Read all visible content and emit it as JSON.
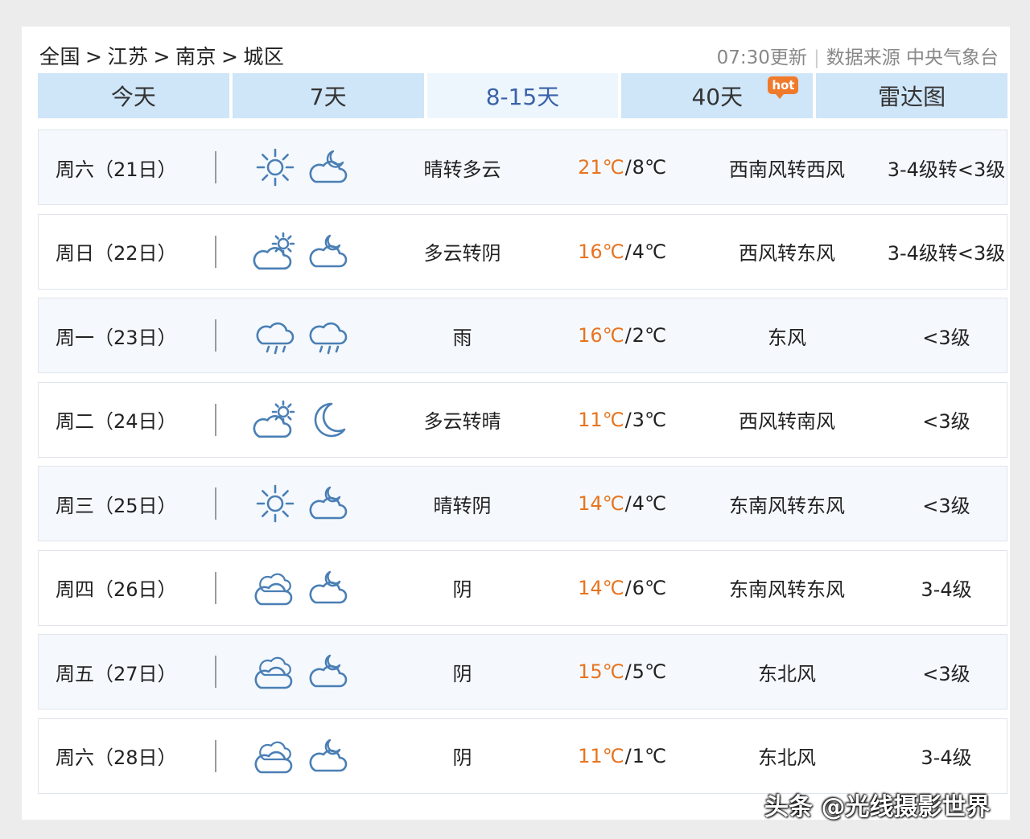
{
  "breadcrumb": {
    "items": [
      "全国",
      "江苏",
      "南京",
      "城区"
    ],
    "separator": ">"
  },
  "update": {
    "time": "07:30更新",
    "source": "数据来源 中央气象台"
  },
  "tabs": [
    {
      "label": "今天"
    },
    {
      "label": "7天"
    },
    {
      "label": "8-15天",
      "active": true
    },
    {
      "label": "40天",
      "badge": "hot"
    },
    {
      "label": "雷达图"
    }
  ],
  "colors": {
    "high_temp": "#e8741f",
    "tab_bg": "#cfe5f8",
    "active_tab_text": "#3a62a8",
    "icon_stroke": "#4a7fb5"
  },
  "forecast": [
    {
      "date": "周六（21日）",
      "day_icon": "sunny-icon",
      "night_icon": "cloudy-night-icon",
      "desc": "晴转多云",
      "high": "21℃",
      "low": "8℃",
      "wind": "西南风转西风",
      "level": "3-4级转<3级"
    },
    {
      "date": "周日（22日）",
      "day_icon": "partly-cloudy-day-icon",
      "night_icon": "partly-cloudy-night-icon",
      "desc": "多云转阴",
      "high": "16℃",
      "low": "4℃",
      "wind": "西风转东风",
      "level": "3-4级转<3级"
    },
    {
      "date": "周一（23日）",
      "day_icon": "rain-icon",
      "night_icon": "rain-icon",
      "desc": "雨",
      "high": "16℃",
      "low": "2℃",
      "wind": "东风",
      "level": "<3级"
    },
    {
      "date": "周二（24日）",
      "day_icon": "partly-cloudy-day-icon",
      "night_icon": "moon-icon",
      "desc": "多云转晴",
      "high": "11℃",
      "low": "3℃",
      "wind": "西风转南风",
      "level": "<3级"
    },
    {
      "date": "周三（25日）",
      "day_icon": "sunny-icon",
      "night_icon": "partly-cloudy-night-icon",
      "desc": "晴转阴",
      "high": "14℃",
      "low": "4℃",
      "wind": "东南风转东风",
      "level": "<3级"
    },
    {
      "date": "周四（26日）",
      "day_icon": "overcast-icon",
      "night_icon": "partly-cloudy-night-icon",
      "desc": "阴",
      "high": "14℃",
      "low": "6℃",
      "wind": "东南风转东风",
      "level": "3-4级"
    },
    {
      "date": "周五（27日）",
      "day_icon": "overcast-icon",
      "night_icon": "partly-cloudy-night-icon",
      "desc": "阴",
      "high": "15℃",
      "low": "5℃",
      "wind": "东北风",
      "level": "<3级"
    },
    {
      "date": "周六（28日）",
      "day_icon": "overcast-icon",
      "night_icon": "partly-cloudy-night-icon",
      "desc": "阴",
      "high": "11℃",
      "low": "1℃",
      "wind": "东北风",
      "level": "3-4级"
    }
  ],
  "watermark": "头条 @光线摄影世界"
}
